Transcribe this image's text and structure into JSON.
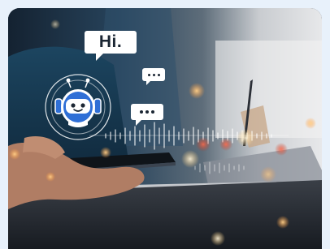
{
  "colors": {
    "page_background": "#e8f1fb",
    "bot_blue": "#2f6fd6",
    "bubble_white": "#ffffff"
  },
  "speech_bubbles": {
    "greeting": "Hi."
  },
  "icons": {
    "chatbot": "robot-head-icon",
    "typing_small": "ellipsis-bubble-icon",
    "typing_medium": "ellipsis-bubble-icon"
  }
}
